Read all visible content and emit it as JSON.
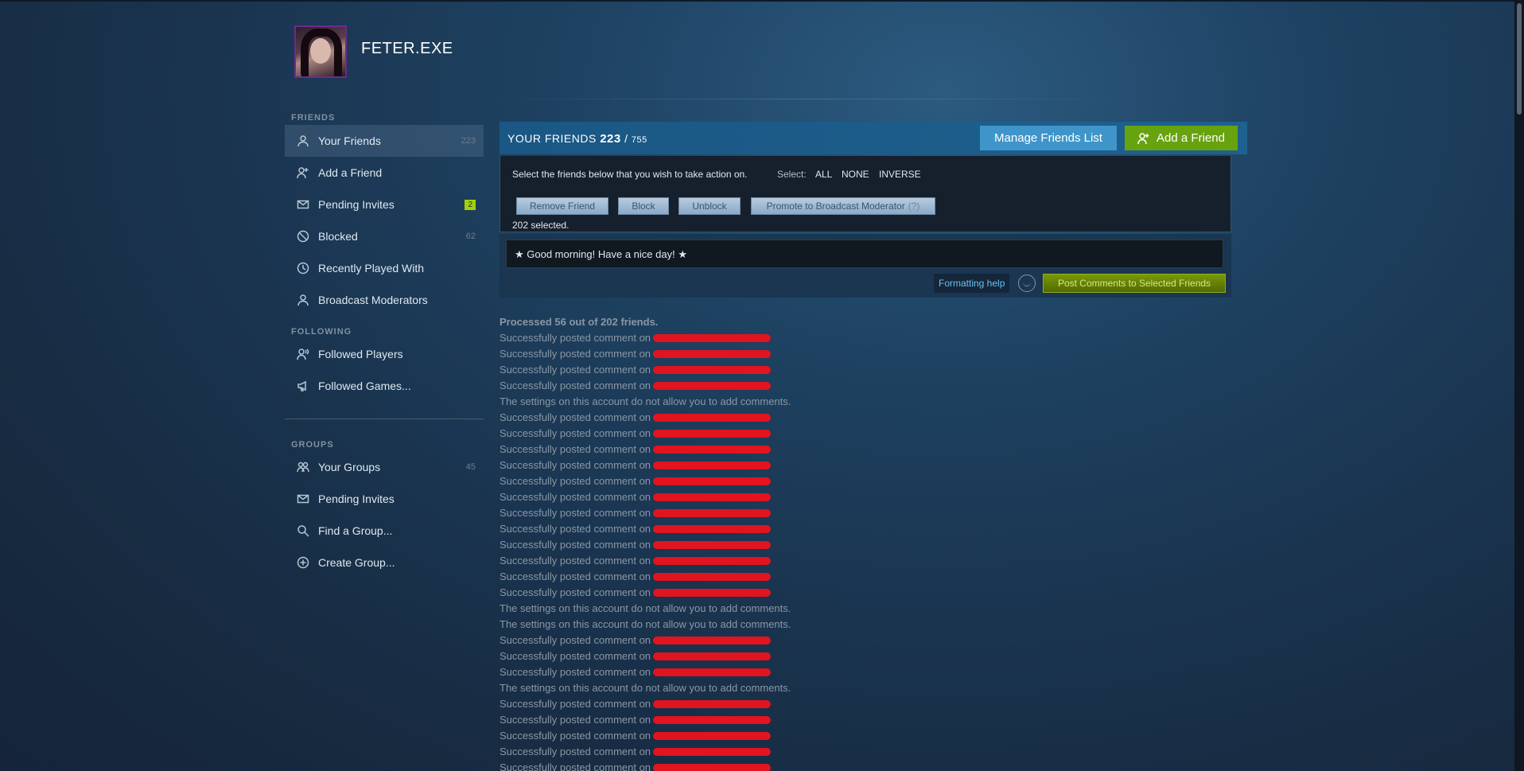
{
  "profile": {
    "username": "FETER.EXE",
    "avatar_icon": "profile-avatar-image"
  },
  "sidebar": {
    "friends_title": "FRIENDS",
    "friends_items": [
      {
        "label": "Your Friends",
        "count": "223",
        "icon": "person-icon"
      },
      {
        "label": "Add a Friend",
        "icon": "add-person-icon"
      },
      {
        "label": "Pending Invites",
        "badge": "2",
        "icon": "envelope-icon"
      },
      {
        "label": "Blocked",
        "count": "62",
        "icon": "blocked-icon"
      },
      {
        "label": "Recently Played With",
        "icon": "clock-icon"
      },
      {
        "label": "Broadcast Moderators",
        "icon": "person-icon"
      }
    ],
    "following_title": "FOLLOWING",
    "following_items": [
      {
        "label": "Followed Players",
        "icon": "followed-person-icon"
      },
      {
        "label": "Followed Games...",
        "icon": "megaphone-icon"
      }
    ],
    "groups_title": "GROUPS",
    "groups_items": [
      {
        "label": "Your Groups",
        "count": "45",
        "icon": "group-icon"
      },
      {
        "label": "Pending Invites",
        "icon": "envelope-icon"
      },
      {
        "label": "Find a Group...",
        "icon": "search-icon"
      },
      {
        "label": "Create Group...",
        "icon": "plus-circle-icon"
      }
    ]
  },
  "friends_header": {
    "title": "YOUR FRIENDS",
    "count": "223",
    "separator": "/",
    "total": "755",
    "manage_label": "Manage Friends List",
    "add_label": "Add a Friend"
  },
  "actions": {
    "instruction": "Select the friends below that you wish to take action on.",
    "select_label": "Select:",
    "select_all": "ALL",
    "select_none": "NONE",
    "select_inverse": "INVERSE",
    "remove_label": "Remove Friend",
    "block_label": "Block",
    "unblock_label": "Unblock",
    "promote_label": "Promote to Broadcast Moderator",
    "promote_count": "(?)",
    "selected_text": "202 selected."
  },
  "comment": {
    "text": "★ Good morning! Have a nice day! ★",
    "formatting_help": "Formatting help",
    "post_label": "Post Comments to Selected Friends"
  },
  "log": {
    "processed": "Processed 56 out of 202 friends.",
    "lines": [
      {
        "text": "Successfully posted comment on",
        "redacted": true
      },
      {
        "text": "Successfully posted comment on",
        "redacted": true
      },
      {
        "text": "Successfully posted comment on",
        "redacted": true
      },
      {
        "text": "Successfully posted comment on",
        "redacted": true
      },
      {
        "text": "The settings on this account do not allow you to add comments.",
        "redacted": false
      },
      {
        "text": "Successfully posted comment on",
        "redacted": true
      },
      {
        "text": "Successfully posted comment on",
        "redacted": true
      },
      {
        "text": "Successfully posted comment on",
        "redacted": true
      },
      {
        "text": "Successfully posted comment on",
        "redacted": true
      },
      {
        "text": "Successfully posted comment on",
        "redacted": true
      },
      {
        "text": "Successfully posted comment on",
        "redacted": true
      },
      {
        "text": "Successfully posted comment on",
        "redacted": true
      },
      {
        "text": "Successfully posted comment on",
        "redacted": true
      },
      {
        "text": "Successfully posted comment on",
        "redacted": true
      },
      {
        "text": "Successfully posted comment on",
        "redacted": true
      },
      {
        "text": "Successfully posted comment on",
        "redacted": true
      },
      {
        "text": "Successfully posted comment on",
        "redacted": true
      },
      {
        "text": "The settings on this account do not allow you to add comments.",
        "redacted": false
      },
      {
        "text": "The settings on this account do not allow you to add comments.",
        "redacted": false
      },
      {
        "text": "Successfully posted comment on",
        "redacted": true
      },
      {
        "text": "Successfully posted comment on",
        "redacted": true
      },
      {
        "text": "Successfully posted comment on",
        "redacted": true
      },
      {
        "text": "The settings on this account do not allow you to add comments.",
        "redacted": false
      },
      {
        "text": "Successfully posted comment on",
        "redacted": true
      },
      {
        "text": "Successfully posted comment on",
        "redacted": true
      },
      {
        "text": "Successfully posted comment on",
        "redacted": true
      },
      {
        "text": "Successfully posted comment on",
        "redacted": true
      },
      {
        "text": "Successfully posted comment on",
        "redacted": true
      }
    ]
  },
  "colors": {
    "accent_blue": "#3f95c9",
    "accent_green": "#67a30f",
    "redaction": "#e1141f",
    "badge_green": "#a4d007"
  }
}
